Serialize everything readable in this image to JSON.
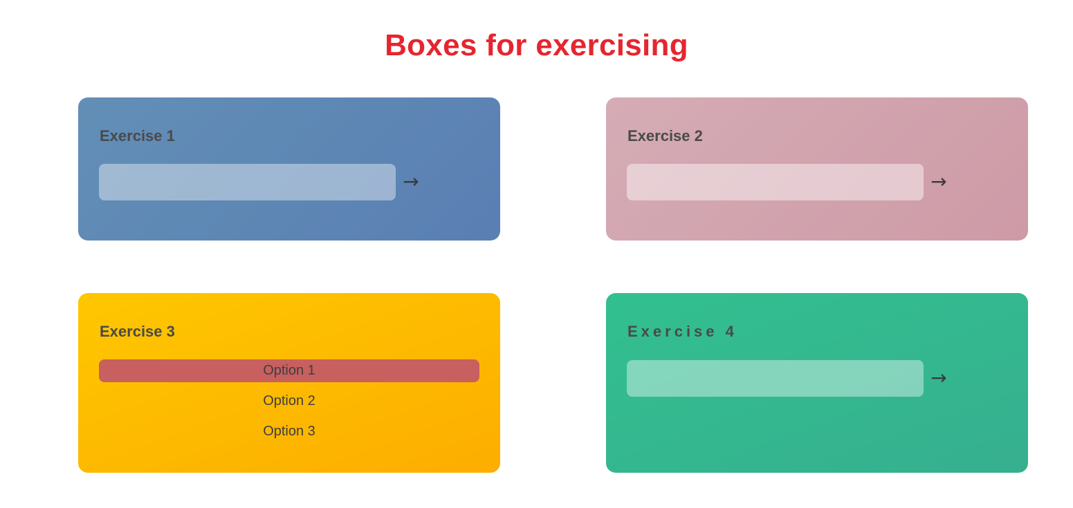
{
  "page": {
    "title": "Boxes for exercising"
  },
  "exercises": [
    {
      "title": "Exercise 1",
      "input_value": "",
      "submit_icon": "→",
      "color": "#5d87b5"
    },
    {
      "title": "Exercise 2",
      "input_value": "",
      "submit_icon": "→",
      "color": "#d1a3ae"
    },
    {
      "title": "Exercise 3",
      "options": [
        "Option 1",
        "Option 2",
        "Option 3"
      ],
      "selected_option": "Option 1",
      "selected_color": "#c7605f",
      "color": "#feba00"
    },
    {
      "title": "Exercise 4",
      "input_value": "",
      "submit_icon": "→",
      "color": "#34b78f"
    }
  ],
  "colors": {
    "title": "#e5262f"
  }
}
